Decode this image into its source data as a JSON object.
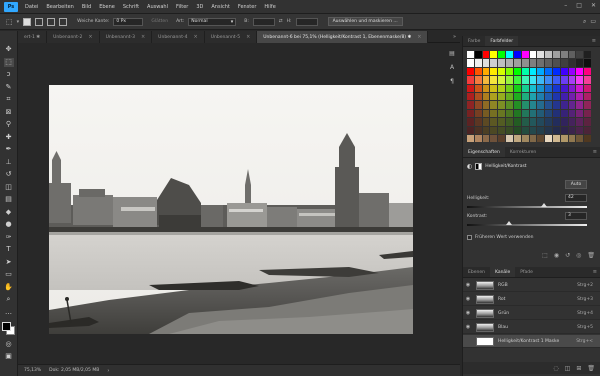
{
  "app": {
    "logo": "Ps"
  },
  "menu": [
    "Datei",
    "Bearbeiten",
    "Bild",
    "Ebene",
    "Schrift",
    "Auswahl",
    "Filter",
    "3D",
    "Ansicht",
    "Fenster",
    "Hilfe"
  ],
  "window_controls": {
    "minimize": "–",
    "maximize": "□",
    "close": "✕"
  },
  "options": {
    "feather_label": "Weiche Kante:",
    "feather_value": "0 Px",
    "smooth_label": "Glätten",
    "style_label": "Art:",
    "style_value": "Normal",
    "width_label": "B:",
    "height_label": "H:",
    "select_mask_button": "Auswählen und maskieren ..."
  },
  "tabs": [
    {
      "label": "ert-1 ✱"
    },
    {
      "label": "Unbenannt-2"
    },
    {
      "label": "Unbenannt-3"
    },
    {
      "label": "Unbenannt-4"
    },
    {
      "label": "Unbenannt-5"
    },
    {
      "label": "Unbenannt-6 bei 75,1% (Helligkeit/Kontrast 1, Ebenenmaske/8) ✱"
    }
  ],
  "status": {
    "zoom": "75,13%",
    "doc": "Dok: 2,05 MB/2,05 MB"
  },
  "color_panel": {
    "tabs": [
      "Farbe",
      "Farbfelder"
    ],
    "active": 1
  },
  "properties": {
    "tabs": [
      "Eigenschaften",
      "Korrekturen"
    ],
    "title": "Helligkeit/Kontrast",
    "auto_button": "Auto",
    "brightness_label": "Helligkeit:",
    "brightness_value": "42",
    "brightness": 42,
    "contrast_label": "Kontrast:",
    "contrast_value": "3",
    "contrast": 3,
    "legacy_label": "Früheren Wert verwenden"
  },
  "layers_panel": {
    "tabs": [
      "Ebenen",
      "Kanäle",
      "Pfade"
    ],
    "active": 1,
    "rows": [
      {
        "name": "RGB",
        "shortcut": "Strg+2"
      },
      {
        "name": "Rot",
        "shortcut": "Strg+3"
      },
      {
        "name": "Grün",
        "shortcut": "Strg+4"
      },
      {
        "name": "Blau",
        "shortcut": "Strg+5"
      },
      {
        "name": "Helligkeit/Kontrast 1 Maske",
        "shortcut": "Strg+<"
      }
    ]
  },
  "colors": {
    "accent": "#31a8ff",
    "panel_bg": "#323232",
    "canvas_bg": "#282828"
  }
}
